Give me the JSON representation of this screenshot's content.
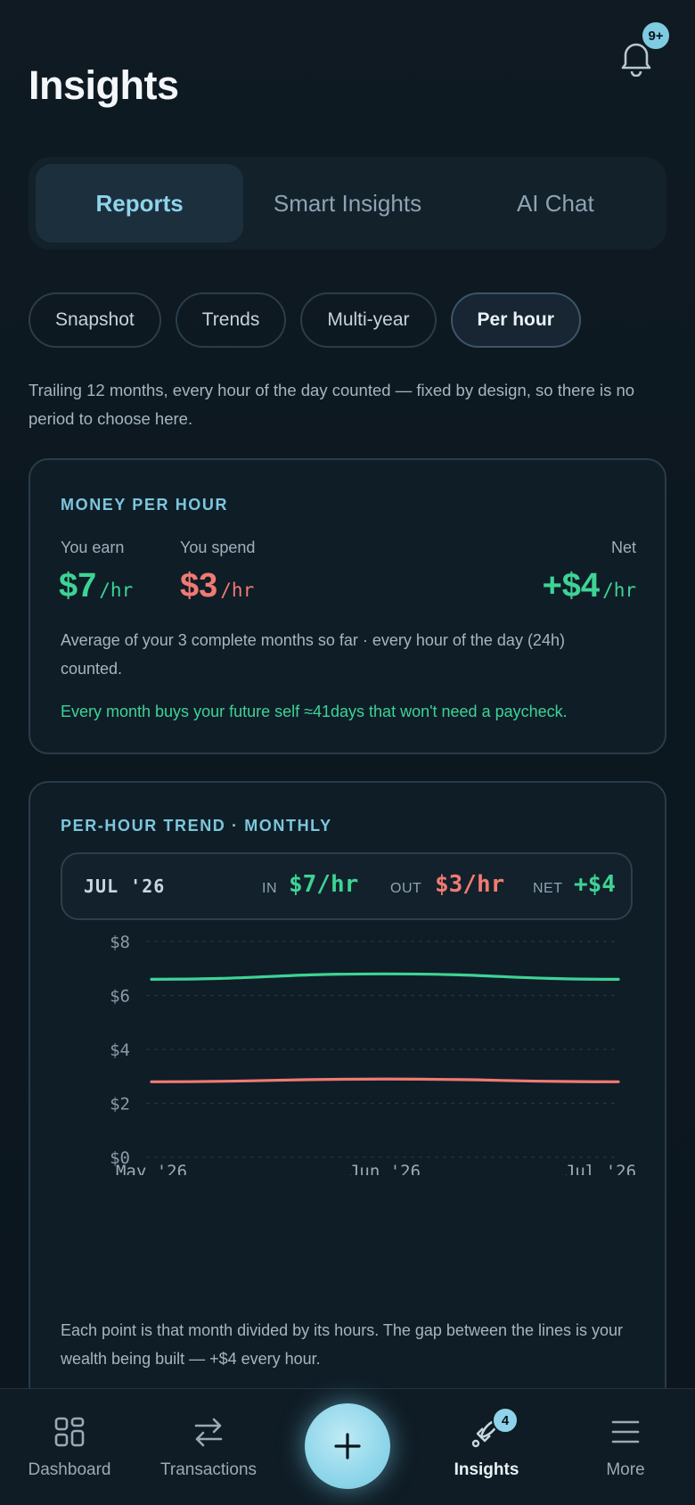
{
  "header": {
    "title": "Insights",
    "notification_badge": "9+"
  },
  "main_tabs": [
    {
      "label": "Reports",
      "active": true
    },
    {
      "label": "Smart Insights",
      "active": false
    },
    {
      "label": "AI Chat",
      "active": false
    }
  ],
  "sub_tabs": [
    {
      "label": "Snapshot",
      "active": false
    },
    {
      "label": "Trends",
      "active": false
    },
    {
      "label": "Multi-year",
      "active": false
    },
    {
      "label": "Per hour",
      "active": true
    }
  ],
  "intro": "Trailing 12 months, every hour of the day counted — fixed by design, so there is no period to choose here.",
  "money_per_hour": {
    "label": "MONEY PER HOUR",
    "earn_caption": "You earn",
    "earn_value": "$7",
    "spend_caption": "You spend",
    "spend_value": "$3",
    "net_caption": "Net",
    "net_value": "+$4",
    "unit": "/hr",
    "note": "Average of your 3 complete months so far · every hour of the day (24h) counted.",
    "highlight": "Every month buys your future self ≈41days that won't need a paycheck."
  },
  "trend_card": {
    "label": "PER-HOUR TREND · MONTHLY",
    "readout": {
      "month": "JUL '26",
      "in_label": "IN",
      "in_value": "$7/hr",
      "out_label": "OUT",
      "out_value": "$3/hr",
      "net_label": "NET",
      "net_value": "+$4"
    },
    "note": "Each point is that month divided by its hours. The gap between the lines is your wealth being built — +$4 every hour."
  },
  "chart_data": {
    "type": "line",
    "x": [
      "May '26",
      "Jun '26",
      "Jul '26"
    ],
    "series": [
      {
        "name": "IN",
        "values": [
          6.6,
          6.8,
          6.6
        ],
        "color": "#3ed395"
      },
      {
        "name": "OUT",
        "values": [
          2.8,
          2.9,
          2.8
        ],
        "color": "#f07a72"
      }
    ],
    "y_ticks": [
      "$0",
      "$2",
      "$4",
      "$6",
      "$8"
    ],
    "ylim": [
      0,
      8
    ],
    "grid": true
  },
  "colors": {
    "accent": "#8fd3ea",
    "positive": "#3ed395",
    "negative": "#f07a72",
    "background": "#0f1a23"
  },
  "bottom_nav": [
    {
      "label": "Dashboard",
      "icon": "dashboard-icon",
      "active": false
    },
    {
      "label": "Transactions",
      "icon": "transfer-icon",
      "active": false
    },
    {
      "label": "Insights",
      "icon": "rocket-icon",
      "active": true,
      "badge": "4"
    },
    {
      "label": "More",
      "icon": "menu-icon",
      "active": false
    }
  ],
  "fab": {
    "icon": "plus-icon"
  }
}
